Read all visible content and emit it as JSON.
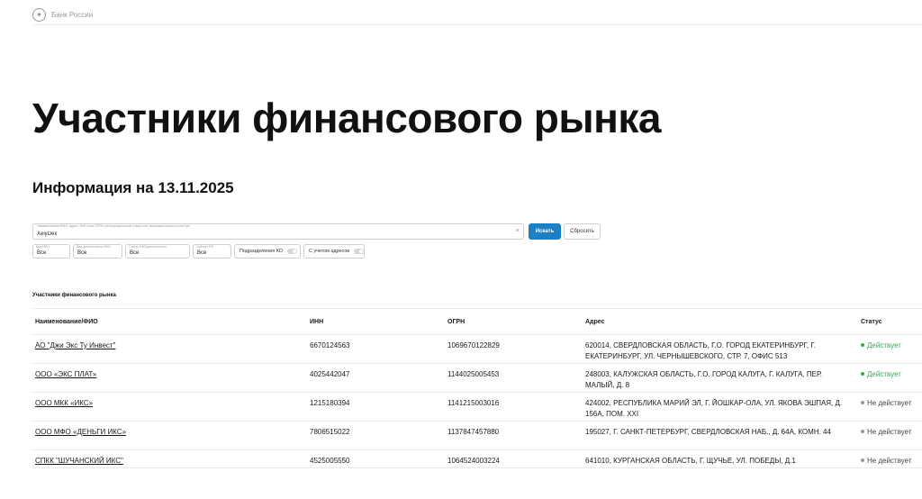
{
  "header": {
    "logo_text": "Банк России"
  },
  "page": {
    "title": "Участники финансового рынка",
    "info_heading": "Информация на 13.11.2025"
  },
  "search": {
    "caption": "Наименование/ФИО, адрес, ИНН или ОГРН, регистрационный номер или лицензии/записи в реестре",
    "value": "XeiyDex",
    "find_label": "Искать",
    "reset_label": "Сбросить"
  },
  "filters": [
    {
      "caption": "Вид НФО",
      "value": "Все"
    },
    {
      "caption": "Вид деятельности НФО",
      "value": "Все"
    },
    {
      "caption": "Статус НФО/деятельности",
      "value": "Все"
    },
    {
      "caption": "Субъект РФ",
      "value": "Все"
    }
  ],
  "toggles": [
    {
      "label": "Подразделения КО"
    },
    {
      "label": "С учетом адресов"
    }
  ],
  "results": {
    "label": "Участники финансового рынка",
    "columns": [
      "Наименование/ФИО",
      "ИНН",
      "ОГРН",
      "Адрес",
      "Статус"
    ],
    "rows": [
      {
        "name": "АО \"Джи Экс Ту Инвест\"",
        "inn": "6670124563",
        "ogrn": "1069670122829",
        "address": "620014, СВЕРДЛОВСКАЯ ОБЛАСТЬ, Г.О. ГОРОД ЕКАТЕРИНБУРГ, Г. ЕКАТЕРИНБУРГ, УЛ. ЧЕРНЫШЕВСКОГО, СТР. 7, ОФИС 513",
        "status": "Действует",
        "status_color": "#3aa757"
      },
      {
        "name": "ООО «ЭКС ПЛАТ»",
        "inn": "4025442047",
        "ogrn": "1144025005453",
        "address": "248003, КАЛУЖСКАЯ ОБЛАСТЬ, Г.О. ГОРОД КАЛУГА, Г. КАЛУГА, ПЕР. МАЛЫЙ, Д. 8",
        "status": "Действует",
        "status_color": "#3aa757"
      },
      {
        "name": "ООО МКК «ИКС»",
        "inn": "1215180394",
        "ogrn": "1141215003016",
        "address": "424002, РЕСПУБЛИКА МАРИЙ ЭЛ, Г. ЙОШКАР-ОЛА, УЛ. ЯКОВА ЭШПАЯ, Д. 156А, ПОМ. XXI",
        "status": "Не действует",
        "status_color": "#9a9a9a"
      },
      {
        "name": "ООО МФО «ДЕНЬГИ ИКС»",
        "inn": "7806515022",
        "ogrn": "1137847457880",
        "address": "195027, Г. САНКТ-ПЕТЕРБУРГ, СВЕРДЛОВСКАЯ НАБ., Д. 64А, КОМН. 44",
        "status": "Не действует",
        "status_color": "#9a9a9a"
      },
      {
        "name": "СПКК \"ШУЧАНСКИЙ ИКС\"",
        "inn": "4525005550",
        "ogrn": "1064524003224",
        "address": "641010, КУРГАНСКАЯ ОБЛАСТЬ, Г. ЩУЧЬЕ, УЛ. ПОБЕДЫ, Д.1",
        "status": "Не действует",
        "status_color": "#9a9a9a"
      }
    ]
  }
}
